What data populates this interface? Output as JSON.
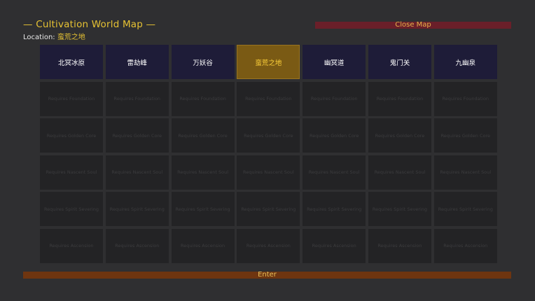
{
  "header": {
    "title": "— Cultivation World Map —",
    "location_label": "Location: ",
    "location_value": "蛮荒之地",
    "close_label": "Close Map"
  },
  "map": {
    "regions": [
      {
        "name": "北冥冰原",
        "current": false
      },
      {
        "name": "雷劫峰",
        "current": false
      },
      {
        "name": "万妖谷",
        "current": false
      },
      {
        "name": "蛮荒之地",
        "current": true
      },
      {
        "name": "幽冥道",
        "current": false
      },
      {
        "name": "鬼门关",
        "current": false
      },
      {
        "name": "九幽泉",
        "current": false
      }
    ],
    "locked_rows": [
      {
        "requirement": "Requires Foundation",
        "columns": 7
      },
      {
        "requirement": "Requires Golden Core",
        "columns": 7
      },
      {
        "requirement": "Requires Nascent Soul",
        "columns": 7
      },
      {
        "requirement": "Requires Spirit Severing",
        "columns": 7
      },
      {
        "requirement": "Requires Ascension",
        "columns": 7
      }
    ]
  },
  "footer": {
    "enter_label": "Enter"
  },
  "colors": {
    "accent_gold": "#e6c233",
    "region_bg": "#1e1c38",
    "current_region_bg": "#7a5a14",
    "locked_bg": "#232325",
    "close_bg": "#6a1f29",
    "enter_bg": "#6e3510"
  }
}
